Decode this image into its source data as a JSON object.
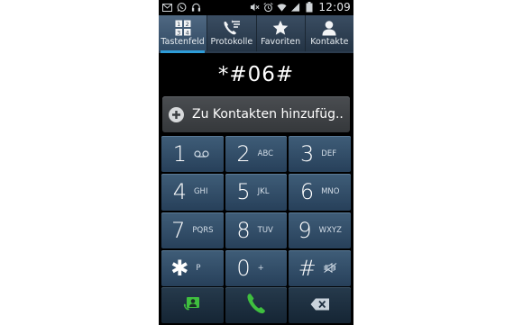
{
  "status_bar": {
    "time": "12:09",
    "left_icons": [
      "mail-icon",
      "whatsapp-icon",
      "headset-icon"
    ],
    "right_icons": [
      "mute-icon",
      "alarm-icon",
      "wifi-icon",
      "signal-icon",
      "battery-icon"
    ]
  },
  "tabs": [
    {
      "label": "Tastenfeld",
      "icon": "keypad-icon",
      "active": true
    },
    {
      "label": "Protokolle",
      "icon": "call-log-icon",
      "active": false
    },
    {
      "label": "Favoriten",
      "icon": "star-icon",
      "active": false
    },
    {
      "label": "Kontakte",
      "icon": "contact-icon",
      "active": false
    }
  ],
  "display": {
    "number": "*#06#"
  },
  "add_contact": {
    "label": "Zu Kontakten hinzufüg.."
  },
  "keys": [
    {
      "digit": "1",
      "letters": "",
      "icon": "voicemail-icon"
    },
    {
      "digit": "2",
      "letters": "ABC"
    },
    {
      "digit": "3",
      "letters": "DEF"
    },
    {
      "digit": "4",
      "letters": "GHI"
    },
    {
      "digit": "5",
      "letters": "JKL"
    },
    {
      "digit": "6",
      "letters": "MNO"
    },
    {
      "digit": "7",
      "letters": "PQRS"
    },
    {
      "digit": "8",
      "letters": "TUV"
    },
    {
      "digit": "9",
      "letters": "WXYZ"
    },
    {
      "digit": "✱",
      "letters": "P"
    },
    {
      "digit": "0",
      "letters": "+"
    },
    {
      "digit": "#",
      "letters": "",
      "icon": "vibrate-mute-icon"
    }
  ],
  "actions": [
    "contacts-action-icon",
    "call-icon",
    "backspace-icon"
  ],
  "colors": {
    "accent": "#2e9cd8",
    "key_bg": "#33506b",
    "call_green": "#3fbf3f"
  }
}
